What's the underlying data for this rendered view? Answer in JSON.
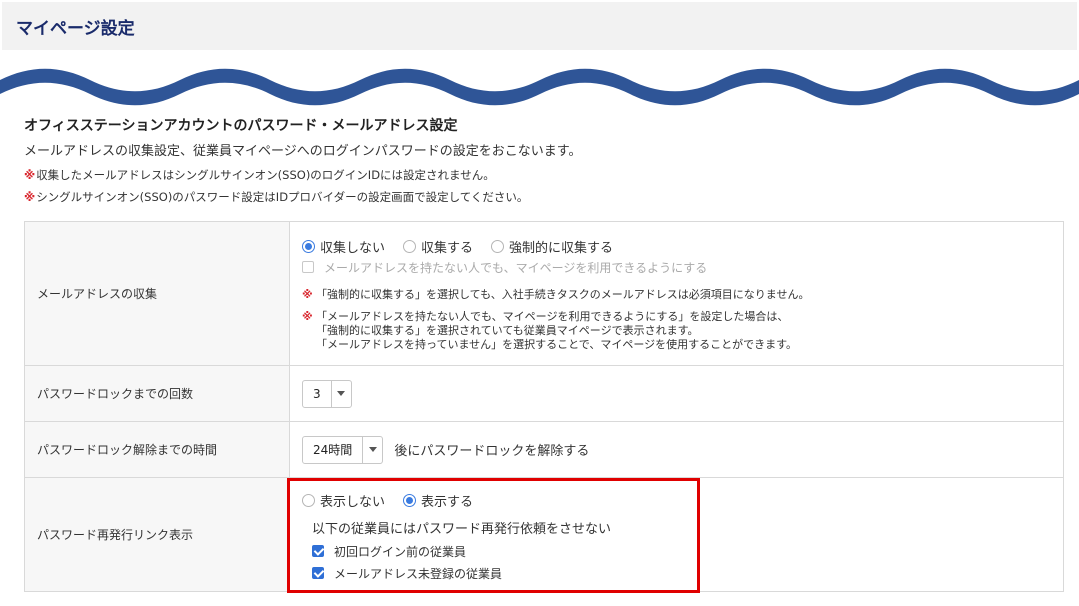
{
  "header": {
    "title": "マイページ設定"
  },
  "section": {
    "title": "オフィスステーションアカウントのパスワード・メールアドレス設定",
    "description": "メールアドレスの収集設定、従業員マイページへのログインパスワードの設定をおこないます。",
    "note_mark": "※",
    "notes": [
      "収集したメールアドレスはシングルサインオン(SSO)のログインIDには設定されません。",
      "シングルサインオン(SSO)のパスワード設定はIDプロバイダーの設定画面で設定してください。"
    ]
  },
  "rows": {
    "email": {
      "label": "メールアドレスの収集",
      "options": [
        "収集しない",
        "収集する",
        "強制的に収集する"
      ],
      "checkbox_label": "メールアドレスを持たない人でも、マイページを利用できるようにする",
      "warning1": "「強制的に収集する」を選択しても、入社手続きタスクのメールアドレスは必須項目になりません。",
      "warning2": [
        "「メールアドレスを持たない人でも、マイページを利用できるようにする」を設定した場合は、",
        "「強制的に収集する」を選択されていても従業員マイページで表示されます。",
        "「メールアドレスを持っていません」を選択することで、マイページを使用することができます。"
      ]
    },
    "lock_count": {
      "label": "パスワードロックまでの回数",
      "value": "3"
    },
    "lock_time": {
      "label": "パスワードロック解除までの時間",
      "value": "24時間",
      "suffix": "後にパスワードロックを解除する"
    },
    "reissue": {
      "label": "パスワード再発行リンク表示",
      "options": [
        "表示しない",
        "表示する"
      ],
      "subheading": "以下の従業員にはパスワード再発行依頼をさせない",
      "checkboxes": [
        "初回ログイン前の従業員",
        "メールアドレス未登録の従業員"
      ]
    }
  },
  "colors": {
    "accent": "#3a7be0",
    "title": "#1a2b6b",
    "warning": "#d8262d",
    "highlight": "#e00000",
    "wave": "#2f5597"
  }
}
